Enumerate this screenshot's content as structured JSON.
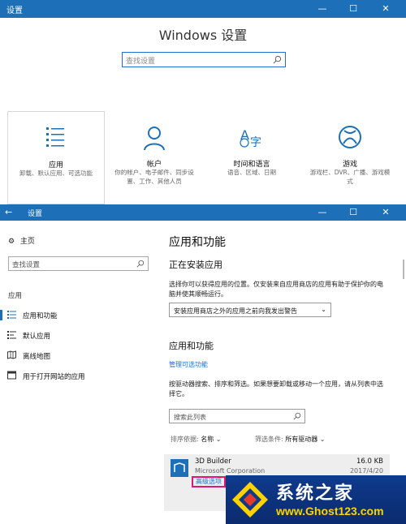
{
  "window1": {
    "title": "设置",
    "controls": [
      "—",
      "☐",
      "✕"
    ],
    "heading": "Windows 设置",
    "search_placeholder": "查找设置",
    "categories": [
      {
        "name": "应用",
        "desc": "卸载、默认应用、可选功能",
        "icon": "apps-list-icon"
      },
      {
        "name": "帐户",
        "desc": "你的帐户、电子邮件、同步设置、工作、其他人员",
        "icon": "person-icon"
      },
      {
        "name": "时间和语言",
        "desc": "语音、区域、日期",
        "icon": "time-language-icon"
      },
      {
        "name": "游戏",
        "desc": "游戏栏、DVR、广播、游戏模式",
        "icon": "xbox-icon"
      }
    ]
  },
  "window2": {
    "back": "←",
    "title": "设置",
    "controls": [
      "—",
      "☐",
      "✕"
    ],
    "sidebar": {
      "home": "主页",
      "search_placeholder": "查找设置",
      "section": "应用",
      "items": [
        {
          "label": "应用和功能",
          "icon": "apps-features-icon",
          "selected": true
        },
        {
          "label": "默认应用",
          "icon": "default-apps-icon",
          "selected": false
        },
        {
          "label": "离线地图",
          "icon": "offline-maps-icon",
          "selected": false
        },
        {
          "label": "用于打开网站的应用",
          "icon": "apps-for-websites-icon",
          "selected": false
        }
      ]
    },
    "main": {
      "title": "应用和功能",
      "installing_heading": "正在安装应用",
      "installing_desc": "选择你可以获得应用的位置。仅安装来自应用商店的应用有助于保护你的电脑并使其顺畅运行。",
      "install_dropdown": "安装应用商店之外的应用之前向我发出警告",
      "apps_heading": "应用和功能",
      "manage_link": "管理可选功能",
      "apps_desc": "按驱动器搜索、排序和筛选。如果想要卸载或移动一个应用，请从列表中选择它。",
      "search_placeholder": "搜索此列表",
      "sort_label": "排序依据:",
      "sort_value": "名称",
      "filter_label": "筛选条件:",
      "filter_value": "所有驱动器",
      "app": {
        "name": "3D Builder",
        "publisher": "Microsoft Corporation",
        "size": "16.0 KB",
        "date": "2017/4/20",
        "advanced_link": "高级选项"
      }
    }
  },
  "watermark": {
    "title": "系统之家",
    "url": "www.Ghost123.com"
  },
  "colors": {
    "accent": "#1d6fb8",
    "link": "#1f6fd0",
    "highlight": "#e0177a"
  }
}
